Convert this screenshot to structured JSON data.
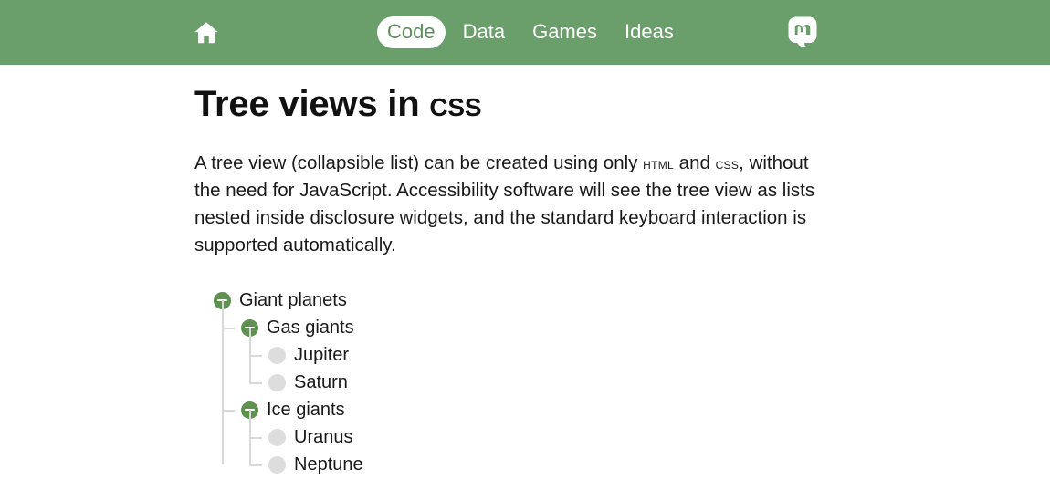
{
  "header": {
    "home_icon": "home-icon",
    "social_icon": "mastodon-icon",
    "nav": [
      {
        "label": "Code",
        "active": true
      },
      {
        "label": "Data",
        "active": false
      },
      {
        "label": "Games",
        "active": false
      },
      {
        "label": "Ideas",
        "active": false
      }
    ],
    "background_color": "#6a9e6a",
    "active_pill_color": "#ffffff",
    "active_pill_text_color": "#5d8d5d"
  },
  "main": {
    "title_parts": {
      "lead": "Tree views in ",
      "abbr": "css"
    },
    "intro": {
      "p1": "A tree view (collapsible list) can be created using only ",
      "abbr1": "HTML",
      "p2": " and ",
      "abbr2": "CSS",
      "p3": ", without the need for JavaScript. Accessibility software will see the tree view as lists nested inside disclosure widgets, and the standard keyboard interaction is supported automatically."
    },
    "tree": {
      "root": {
        "label": "Giant planets",
        "expanded": true,
        "children": [
          {
            "label": "Gas giants",
            "expanded": true,
            "children": [
              {
                "label": "Jupiter",
                "expanded": false,
                "children": []
              },
              {
                "label": "Saturn",
                "expanded": false,
                "children": []
              }
            ]
          },
          {
            "label": "Ice giants",
            "expanded": true,
            "children": [
              {
                "label": "Uranus",
                "expanded": false,
                "children": []
              },
              {
                "label": "Neptune",
                "expanded": false,
                "children": []
              }
            ]
          }
        ]
      },
      "branch_marker_color": "#5f9150",
      "leaf_marker_color": "#dddddd",
      "connector_color": "#d8d8d8"
    }
  }
}
